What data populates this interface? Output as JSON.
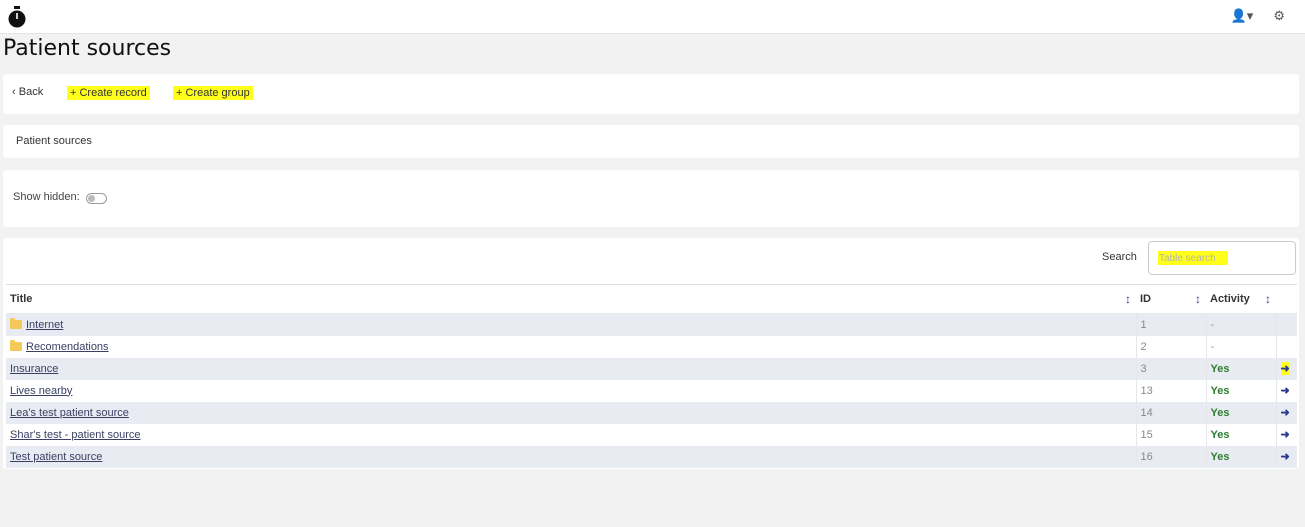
{
  "header": {
    "logo_icon": "stopwatch-icon",
    "user_icon": "user-icon",
    "settings_icon": "gears-icon"
  },
  "page": {
    "title": "Patient sources"
  },
  "actions": {
    "back": "Back",
    "create_record": "Create record",
    "create_group": "Create group"
  },
  "breadcrumb": "Patient sources",
  "filters": {
    "show_hidden_label": "Show hidden:",
    "show_hidden": false
  },
  "search": {
    "label": "Search",
    "placeholder": "Table search"
  },
  "table": {
    "columns": [
      "Title",
      "ID",
      "Activity"
    ],
    "rows": [
      {
        "title": "Internet",
        "id": "1",
        "activity": "-",
        "folder": true
      },
      {
        "title": "Recomendations",
        "id": "2",
        "activity": "-",
        "folder": true
      },
      {
        "title": "Insurance",
        "id": "3",
        "activity": "Yes",
        "folder": false
      },
      {
        "title": "Lives nearby",
        "id": "13",
        "activity": "Yes",
        "folder": false
      },
      {
        "title": "Lea's test patient source",
        "id": "14",
        "activity": "Yes",
        "folder": false
      },
      {
        "title": "Shar's test - patient source",
        "id": "15",
        "activity": "Yes",
        "folder": false
      },
      {
        "title": "Test patient source",
        "id": "16",
        "activity": "Yes",
        "folder": false
      }
    ]
  },
  "colors": {
    "highlight": "#ffff1a",
    "yes": "#2e7d32",
    "row_alt": "#e8ecf2"
  }
}
